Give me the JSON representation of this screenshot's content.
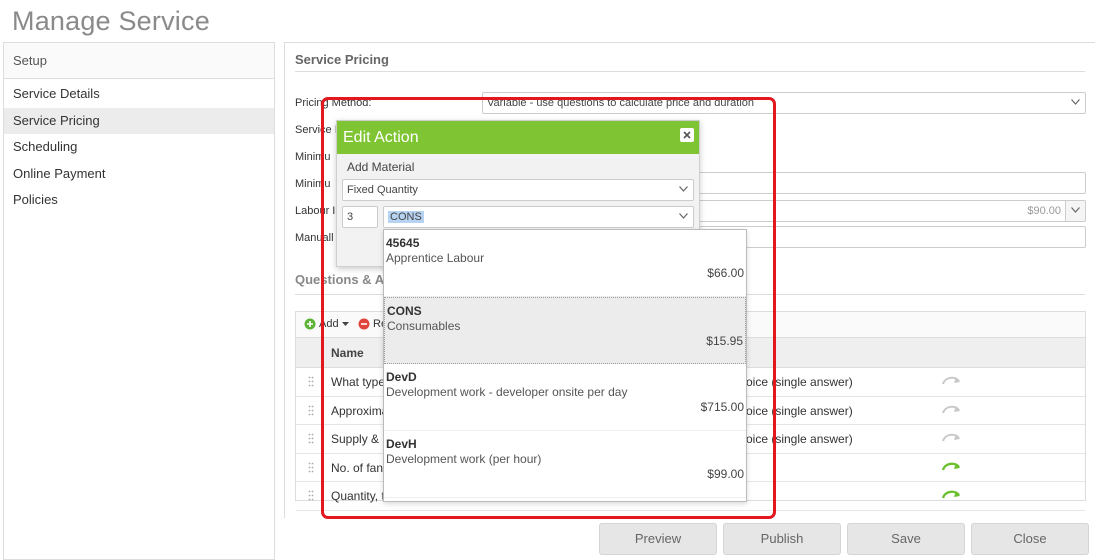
{
  "page_title": "Manage Service",
  "sidebar": {
    "header": "Setup",
    "items": [
      {
        "label": "Service Details",
        "active": false
      },
      {
        "label": "Service Pricing",
        "active": true
      },
      {
        "label": "Scheduling",
        "active": false
      },
      {
        "label": "Online Payment",
        "active": false
      },
      {
        "label": "Policies",
        "active": false
      }
    ]
  },
  "service_pricing": {
    "title": "Service Pricing",
    "pricing_method_label": "Pricing Method:",
    "pricing_method_value": "Variable - use questions to calculate price and duration",
    "labels": {
      "service": "Service I",
      "minimum1": "Minimu",
      "minimum2": "Minimu",
      "labour": "Labour I",
      "manual": "Manuall"
    },
    "labour_rate_value": "$90.00"
  },
  "questions": {
    "title": "Questions & A",
    "toolbar": {
      "add_label": "Add",
      "remove_label": "Re"
    },
    "header_name": "Name",
    "rows": [
      {
        "name": "What type",
        "type": "oice (single answer)",
        "mode": "inactive"
      },
      {
        "name": "Approxima",
        "type": "oice (single answer)",
        "mode": "inactive"
      },
      {
        "name": "Supply & i",
        "type": "oice (single answer)",
        "mode": "inactive"
      },
      {
        "name": "No. of fans",
        "type": "",
        "mode": "active"
      },
      {
        "name": "Quantity, t",
        "type": "",
        "mode": "active"
      }
    ]
  },
  "modal": {
    "title": "Edit Action",
    "subtitle": "Add Material",
    "quantity_mode": "Fixed Quantity",
    "quantity_value": "3",
    "material_value": "CONS"
  },
  "material_options": [
    {
      "code": "45645",
      "description": "Apprentice Labour",
      "price": "$66.00",
      "selected": false
    },
    {
      "code": "CONS",
      "description": "Consumables",
      "price": "$15.95",
      "selected": true
    },
    {
      "code": "DevD",
      "description": "Development work - developer onsite per day",
      "price": "$715.00",
      "selected": false
    },
    {
      "code": "DevH",
      "description": "Development work (per hour)",
      "price": "$99.00",
      "selected": false
    }
  ],
  "footer_buttons": {
    "preview": "Preview",
    "publish": "Publish",
    "save": "Save",
    "close": "Close"
  },
  "colors": {
    "modal_header": "#7fc433",
    "highlight": "#e4171f",
    "active_icon": "#6abf2e"
  }
}
